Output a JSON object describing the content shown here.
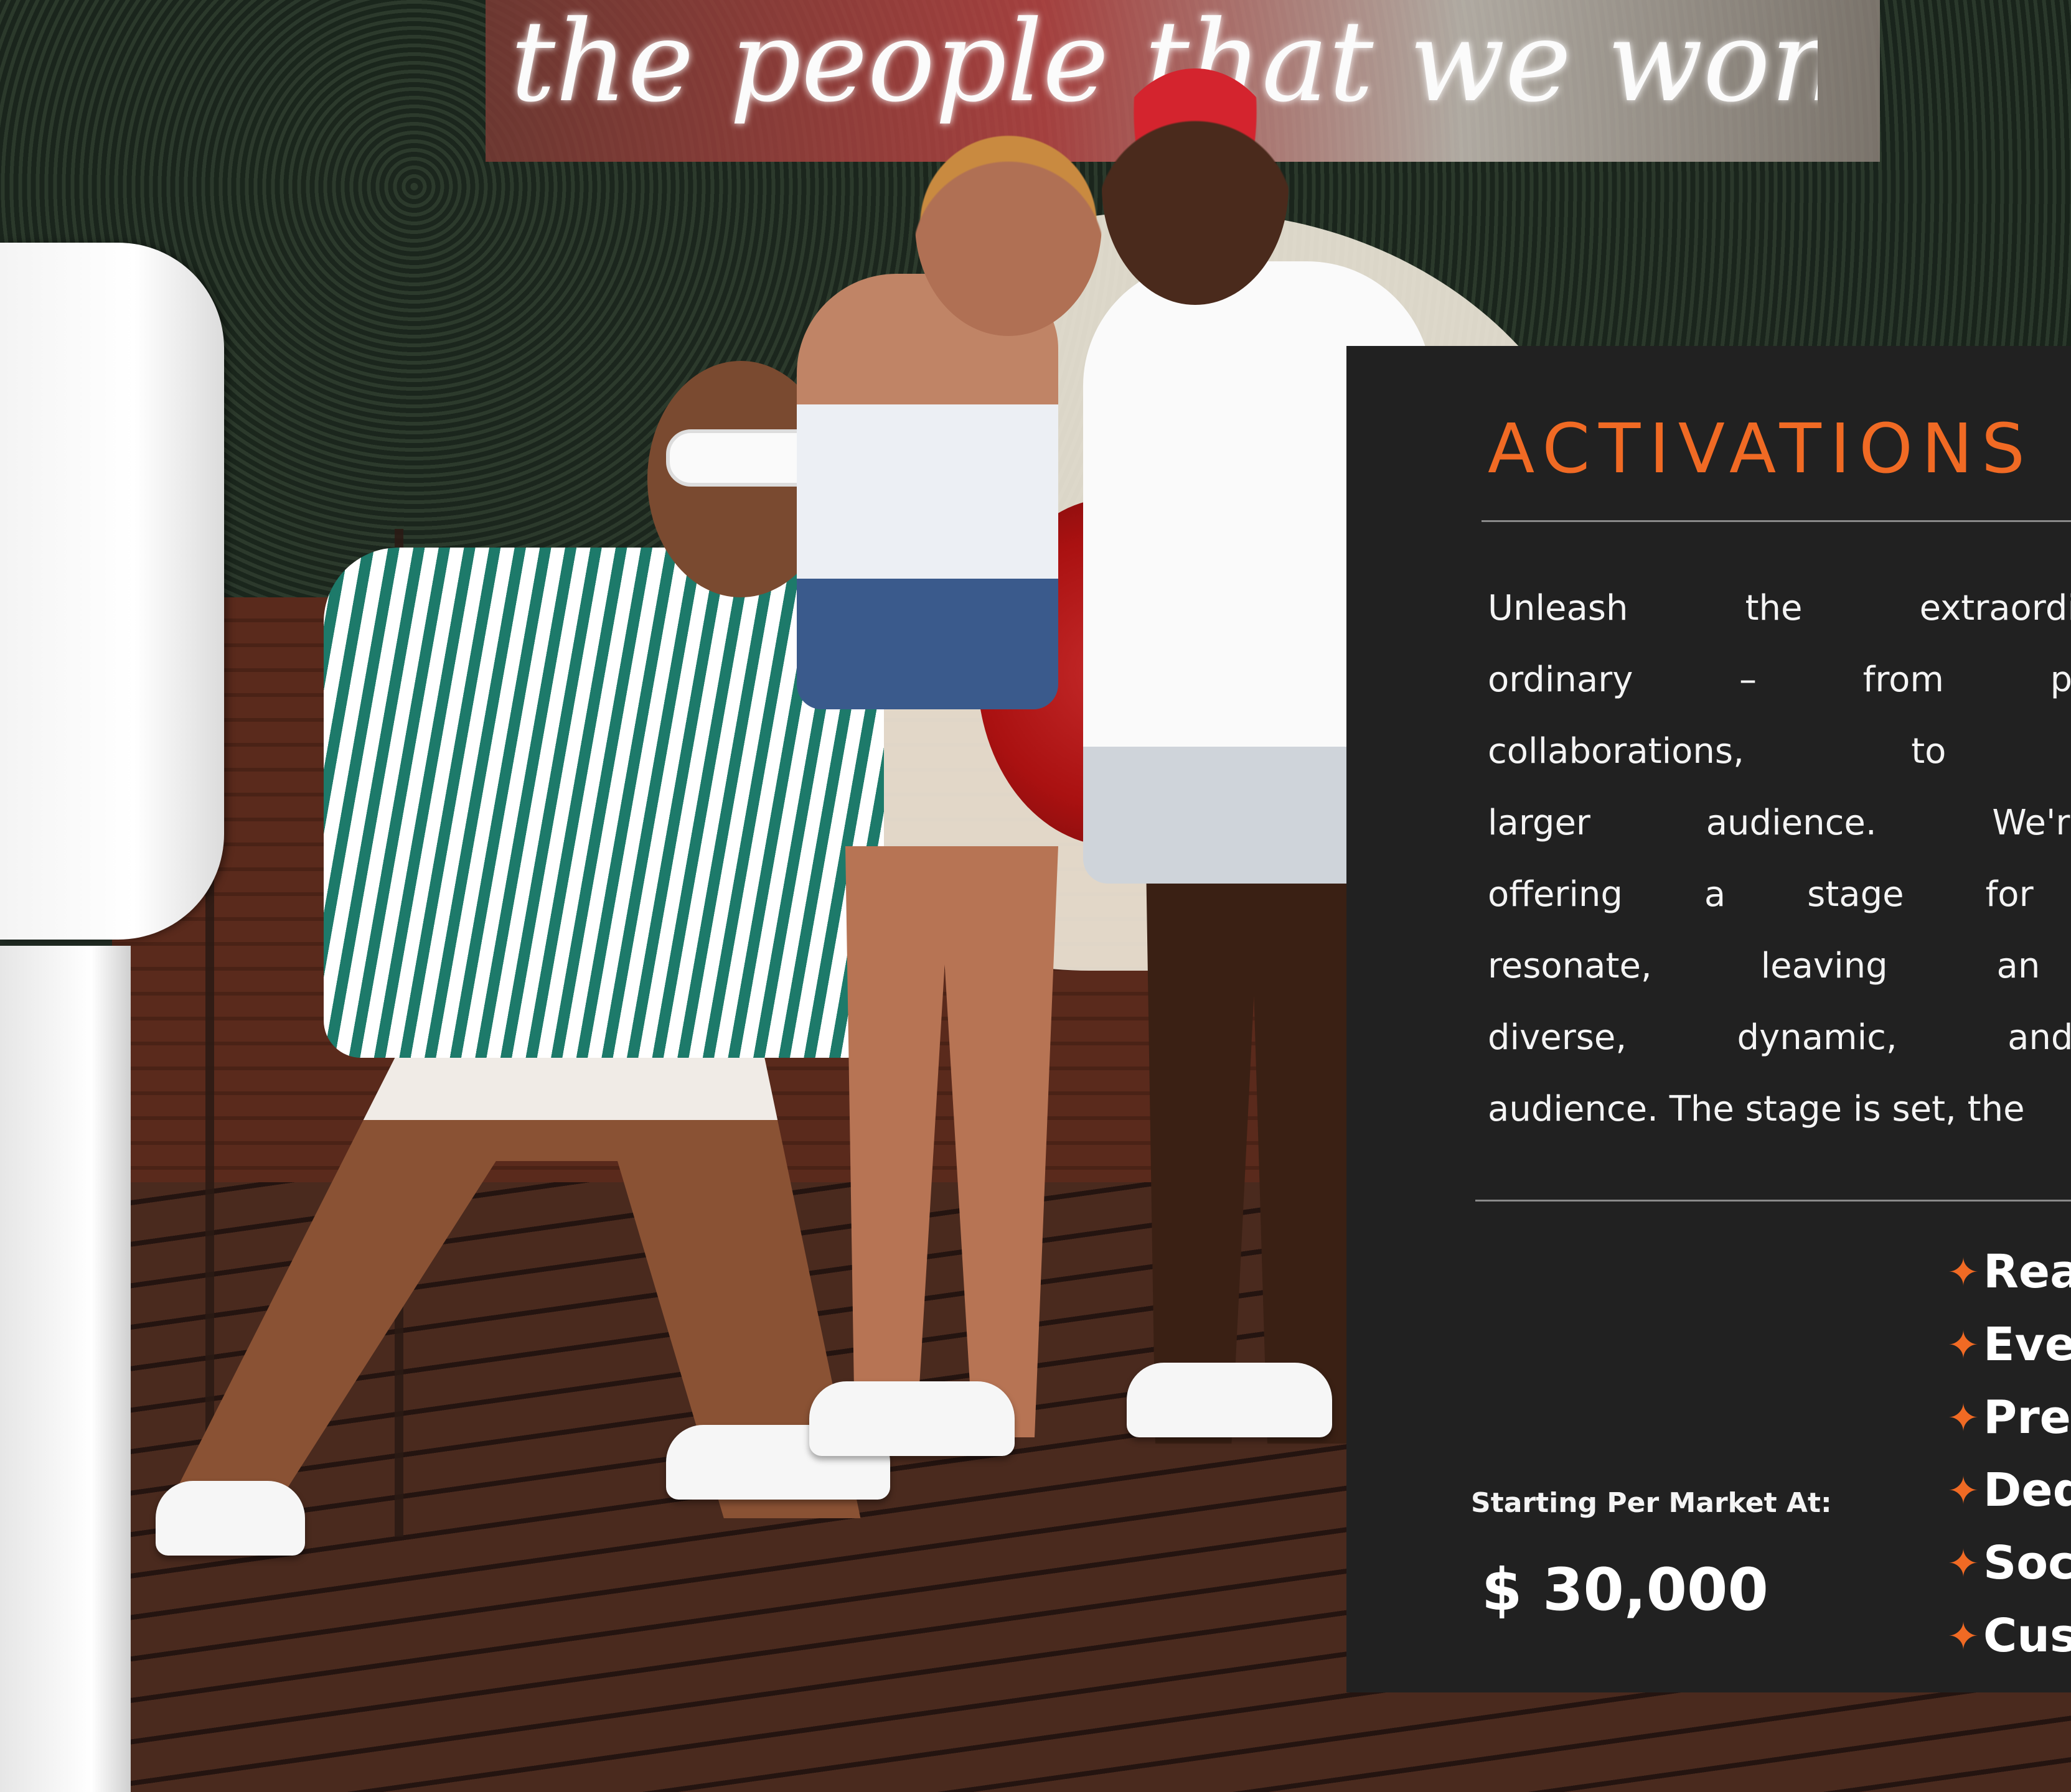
{
  "background": {
    "neon_sign_text": "the people that we won't forget"
  },
  "panel": {
    "title": "ACTIVATIONS",
    "accent_color": "#f06a24",
    "background_color": "#212121",
    "body_lines": [
      "Unleash the extraordinary! J",
      "ordinary – from pop-up s",
      "collaborations, to unforgetta",
      "larger audience.  We're curat",
      "offering a stage for your b",
      "resonate, leaving an indelible",
      "diverse, dynamic, and immer",
      "audience. The stage is set, the"
    ],
    "price_label": "Starting Per Market At:",
    "price_value": "$ 30,000",
    "feature_icon": "four-pointed-star-icon",
    "features": [
      "Rea",
      "Eve",
      "Pres",
      "Ded",
      "Soc",
      "Cus"
    ]
  }
}
